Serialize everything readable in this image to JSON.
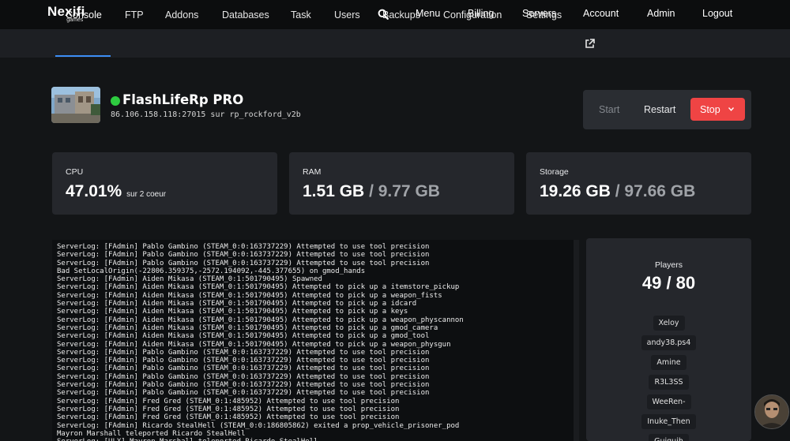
{
  "brand": {
    "name": "Nexifi",
    "sub": "games"
  },
  "topnav": {
    "menu": "Menu",
    "billing": "Billing",
    "servers": "Servers",
    "account": "Account",
    "admin": "Admin",
    "logout": "Logout"
  },
  "tabs": [
    "Console",
    "FTP",
    "Addons",
    "Databases",
    "Task",
    "Users",
    "Backups",
    "Configuration",
    "Settings"
  ],
  "active_tab": "Console",
  "server": {
    "name": "FlashLifeRp PRO",
    "address": "86.106.158.118:27015  sur rp_rockford_v2b",
    "status_color": "#2ecc40"
  },
  "power": {
    "start": "Start",
    "restart": "Restart",
    "stop": "Stop"
  },
  "stats": {
    "cpu": {
      "label": "CPU",
      "value": "47.01%",
      "note": "sur 2 coeur"
    },
    "ram": {
      "label": "RAM",
      "used": "1.51 GB",
      "total": "/ 9.77 GB"
    },
    "storage": {
      "label": "Storage",
      "used": "19.26 GB",
      "total": "/ 97.66 GB"
    }
  },
  "console_lines": [
    "ServerLog: [FAdmin] Pablo Gambino (STEAM_0:0:163737229) Attempted to use tool precision",
    "ServerLog: [FAdmin] Pablo Gambino (STEAM_0:0:163737229) Attempted to use tool precision",
    "ServerLog: [FAdmin] Pablo Gambino (STEAM_0:0:163737229) Attempted to use tool precision",
    "Bad SetLocalOrigin(-22806.359375,-2572.194092,-445.377655) on gmod_hands",
    "ServerLog: [FAdmin] Aiden Mikasa (STEAM_0:1:501790495) Spawned",
    "ServerLog: [FAdmin] Aiden Mikasa (STEAM_0:1:501790495) Attempted to pick up a itemstore_pickup",
    "ServerLog: [FAdmin] Aiden Mikasa (STEAM_0:1:501790495) Attempted to pick up a weapon_fists",
    "ServerLog: [FAdmin] Aiden Mikasa (STEAM_0:1:501790495) Attempted to pick up a idcard",
    "ServerLog: [FAdmin] Aiden Mikasa (STEAM_0:1:501790495) Attempted to pick up a keys",
    "ServerLog: [FAdmin] Aiden Mikasa (STEAM_0:1:501790495) Attempted to pick up a weapon_physcannon",
    "ServerLog: [FAdmin] Aiden Mikasa (STEAM_0:1:501790495) Attempted to pick up a gmod_camera",
    "ServerLog: [FAdmin] Aiden Mikasa (STEAM_0:1:501790495) Attempted to pick up a gmod_tool",
    "ServerLog: [FAdmin] Aiden Mikasa (STEAM_0:1:501790495) Attempted to pick up a weapon_physgun",
    "ServerLog: [FAdmin] Pablo Gambino (STEAM_0:0:163737229) Attempted to use tool precision",
    "ServerLog: [FAdmin] Pablo Gambino (STEAM_0:0:163737229) Attempted to use tool precision",
    "ServerLog: [FAdmin] Pablo Gambino (STEAM_0:0:163737229) Attempted to use tool precision",
    "ServerLog: [FAdmin] Pablo Gambino (STEAM_0:0:163737229) Attempted to use tool precision",
    "ServerLog: [FAdmin] Pablo Gambino (STEAM_0:0:163737229) Attempted to use tool precision",
    "ServerLog: [FAdmin] Pablo Gambino (STEAM_0:0:163737229) Attempted to use tool precision",
    "ServerLog: [FAdmin] Fred Gred (STEAM_0:1:485952) Attempted to use tool precision",
    "ServerLog: [FAdmin] Fred Gred (STEAM_0:1:485952) Attempted to use tool precision",
    "ServerLog: [FAdmin] Fred Gred (STEAM_0:1:485952) Attempted to use tool precision",
    "ServerLog: [FAdmin] Ricardo StealHell (STEAM_0:0:186805862) exited a prop_vehicle_prisoner_pod",
    "Mayron Marshall teleported Ricardo StealHell",
    "ServerLog: [ULX] Mayron Marshall teleported Ricardo StealHell"
  ],
  "players": {
    "title": "Players",
    "count": "49 / 80",
    "names": [
      "Xeloy",
      "andy38.ps4",
      "Amine",
      "R3L3SS",
      "WeeRen-",
      "Inuke_Then",
      "Guiguih"
    ]
  }
}
